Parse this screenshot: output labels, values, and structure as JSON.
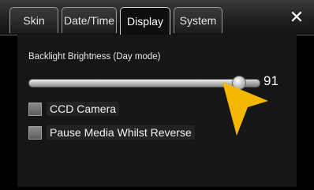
{
  "tabs": [
    {
      "label": "Skin",
      "active": false
    },
    {
      "label": "Date/Time",
      "active": false
    },
    {
      "label": "Display",
      "active": true
    },
    {
      "label": "System",
      "active": false
    }
  ],
  "close_label": "✕",
  "backlight": {
    "label": "Backlight Brightness (Day mode)",
    "value": "91",
    "level_fraction": 0.91
  },
  "options": [
    {
      "label": "CCD Camera",
      "checked": false
    },
    {
      "label": "Pause Media Whilst Reverse",
      "checked": false
    }
  ],
  "colors": {
    "pointer_arrow": "#f5b800",
    "background": "#000000"
  },
  "icons": {
    "pointer": "yellow-pointer-arrow-icon",
    "close": "close-icon"
  }
}
